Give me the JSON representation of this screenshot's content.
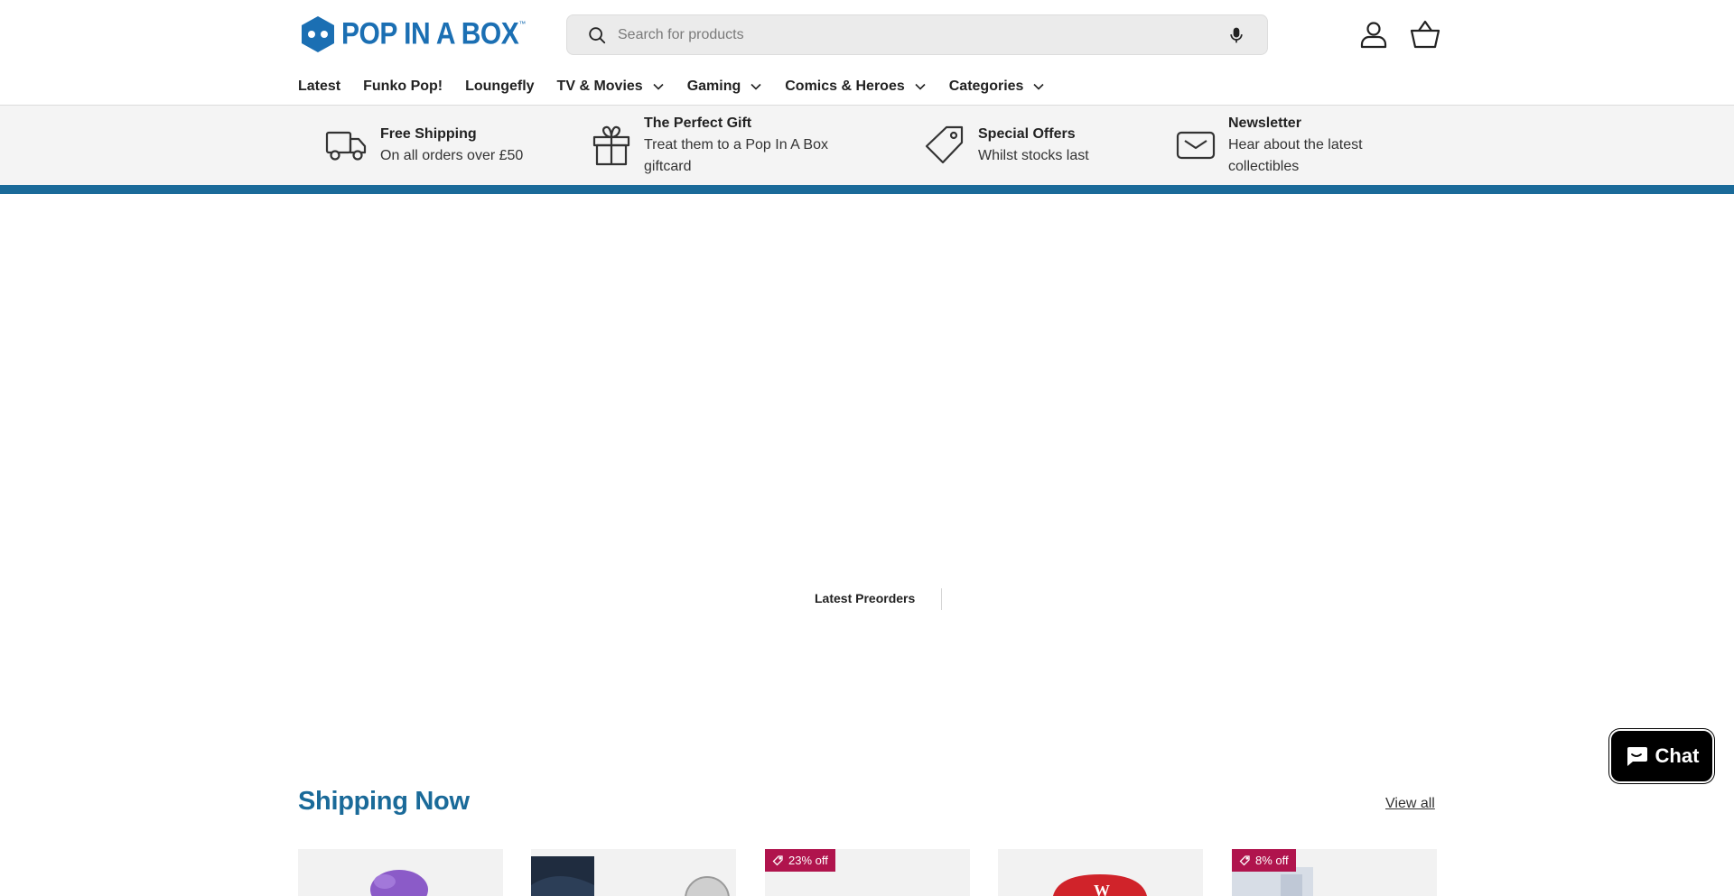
{
  "brand": {
    "name": "POP IN A BOX",
    "tm": "™",
    "color": "#1b6fb3"
  },
  "search": {
    "placeholder": "Search for products"
  },
  "nav": {
    "items": [
      {
        "label": "Latest",
        "dropdown": false
      },
      {
        "label": "Funko Pop!",
        "dropdown": false
      },
      {
        "label": "Loungefly",
        "dropdown": false
      },
      {
        "label": "TV & Movies",
        "dropdown": true
      },
      {
        "label": "Gaming",
        "dropdown": true
      },
      {
        "label": "Comics & Heroes",
        "dropdown": true
      },
      {
        "label": "Categories",
        "dropdown": true
      }
    ]
  },
  "usps": [
    {
      "title": "Free Shipping",
      "sub": "On all orders over £50",
      "icon": "truck-icon"
    },
    {
      "title": "The Perfect Gift",
      "sub": "Treat them to a Pop In A Box giftcard",
      "icon": "gift-icon"
    },
    {
      "title": "Special Offers",
      "sub": "Whilst stocks last",
      "icon": "tag-icon"
    },
    {
      "title": "Newsletter",
      "sub": "Hear about the latest collectibles",
      "icon": "mail-icon"
    }
  ],
  "preorders": {
    "tab_label": "Latest Preorders"
  },
  "shipping_now": {
    "title": "Shipping Now",
    "view_all": "View all",
    "cards": [
      {
        "badge": ""
      },
      {
        "badge": ""
      },
      {
        "badge": "23% off"
      },
      {
        "badge": ""
      },
      {
        "badge": "8% off"
      }
    ]
  },
  "chat": {
    "label": "Chat"
  },
  "colors": {
    "accent": "#1a6a99",
    "sale_badge": "#b0144d",
    "usp_bg": "#f4f4f4"
  }
}
